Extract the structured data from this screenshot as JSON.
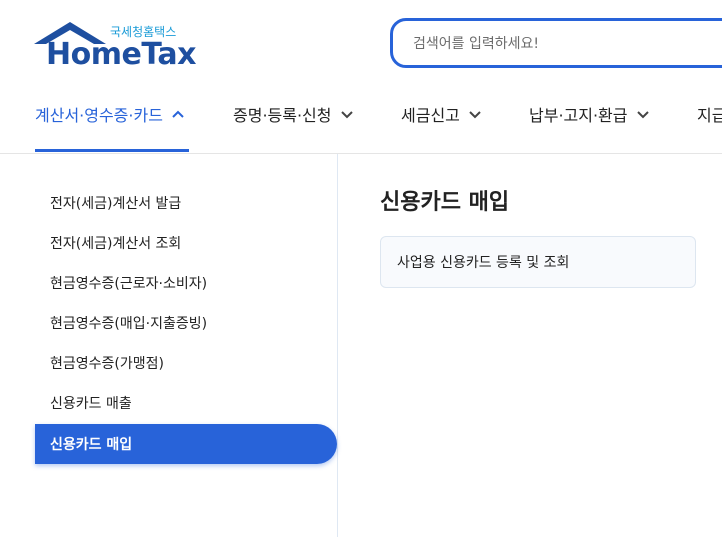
{
  "header": {
    "logo_sub": "국세청홈택스",
    "logo_main": "HomeTax",
    "search_placeholder": "검색어를 입력하세요!",
    "search_value": ""
  },
  "nav": {
    "items": [
      {
        "label": "계산서·영수증·카드",
        "active": true,
        "chevron": "chevron-up"
      },
      {
        "label": "증명·등록·신청",
        "active": false,
        "chevron": "chevron-down"
      },
      {
        "label": "세금신고",
        "active": false,
        "chevron": "chevron-down"
      },
      {
        "label": "납부·고지·환급",
        "active": false,
        "chevron": "chevron-down"
      },
      {
        "label": "지급",
        "active": false
      }
    ]
  },
  "sidebar": {
    "items": [
      {
        "label": "전자(세금)계산서 발급"
      },
      {
        "label": "전자(세금)계산서 조회"
      },
      {
        "label": "현금영수증(근로자·소비자)"
      },
      {
        "label": "현금영수증(매입·지출증빙)"
      },
      {
        "label": "현금영수증(가맹점)"
      },
      {
        "label": "신용카드 매출"
      },
      {
        "label": "신용카드 매입",
        "active": true
      }
    ]
  },
  "main": {
    "title": "신용카드 매입",
    "links": [
      {
        "label": "사업용 신용카드 등록 및 조회"
      }
    ]
  },
  "colors": {
    "accent": "#2863d9",
    "logo_blue": "#1e4fa0",
    "logo_sub": "#1a9bd7"
  }
}
